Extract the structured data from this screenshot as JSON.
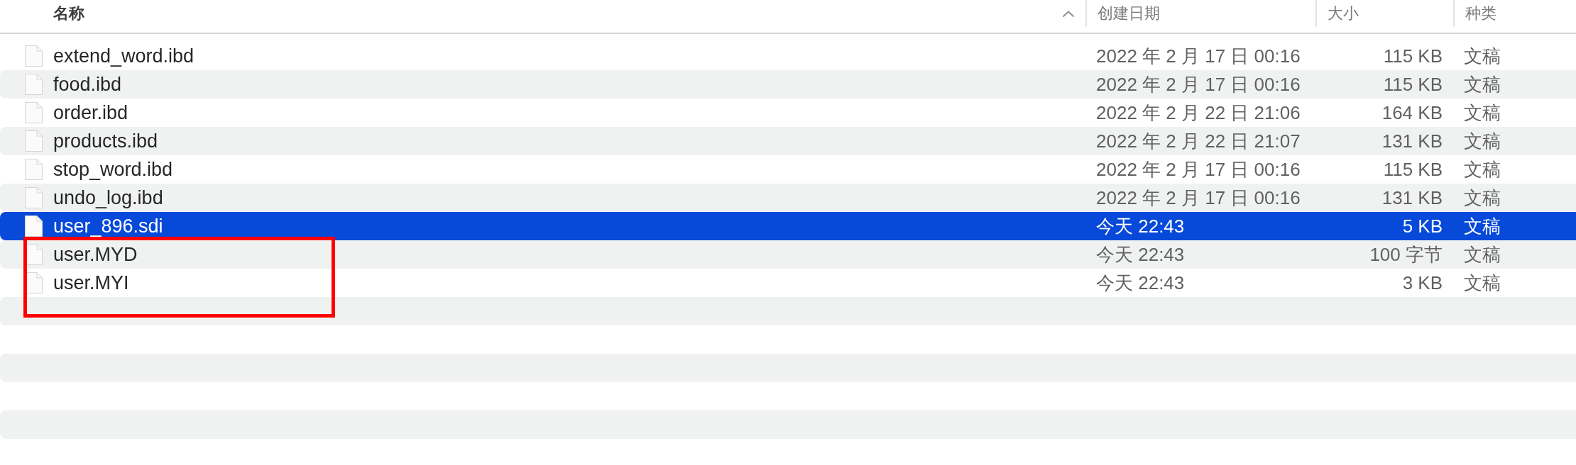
{
  "columns": [
    {
      "label": "名称",
      "sorted": true
    },
    {
      "label": "创建日期",
      "sorted": false
    },
    {
      "label": "大小",
      "sorted": false
    },
    {
      "label": "种类",
      "sorted": false
    }
  ],
  "rows": [
    {
      "name": "extend_word.ibd",
      "created": "2022 年 2 月 17 日 00:16",
      "size": "115 KB",
      "file_type": "文稿",
      "selected": false,
      "highlighted": false
    },
    {
      "name": "food.ibd",
      "created": "2022 年 2 月 17 日 00:16",
      "size": "115 KB",
      "file_type": "文稿",
      "selected": false,
      "highlighted": false
    },
    {
      "name": "order.ibd",
      "created": "2022 年 2 月 22 日 21:06",
      "size": "164 KB",
      "file_type": "文稿",
      "selected": false,
      "highlighted": false
    },
    {
      "name": "products.ibd",
      "created": "2022 年 2 月 22 日 21:07",
      "size": "131 KB",
      "file_type": "文稿",
      "selected": false,
      "highlighted": false
    },
    {
      "name": "stop_word.ibd",
      "created": "2022 年 2 月 17 日 00:16",
      "size": "115 KB",
      "file_type": "文稿",
      "selected": false,
      "highlighted": false
    },
    {
      "name": "undo_log.ibd",
      "created": "2022 年 2 月 17 日 00:16",
      "size": "131 KB",
      "file_type": "文稿",
      "selected": false,
      "highlighted": false
    },
    {
      "name": "user_896.sdi",
      "created": "今天 22:43",
      "size": "5 KB",
      "file_type": "文稿",
      "selected": true,
      "highlighted": false
    },
    {
      "name": "user.MYD",
      "created": "今天 22:43",
      "size": "100 字节",
      "file_type": "文稿",
      "selected": false,
      "highlighted": true
    },
    {
      "name": "user.MYI",
      "created": "今天 22:43",
      "size": "3 KB",
      "file_type": "文稿",
      "selected": false,
      "highlighted": true
    }
  ]
}
